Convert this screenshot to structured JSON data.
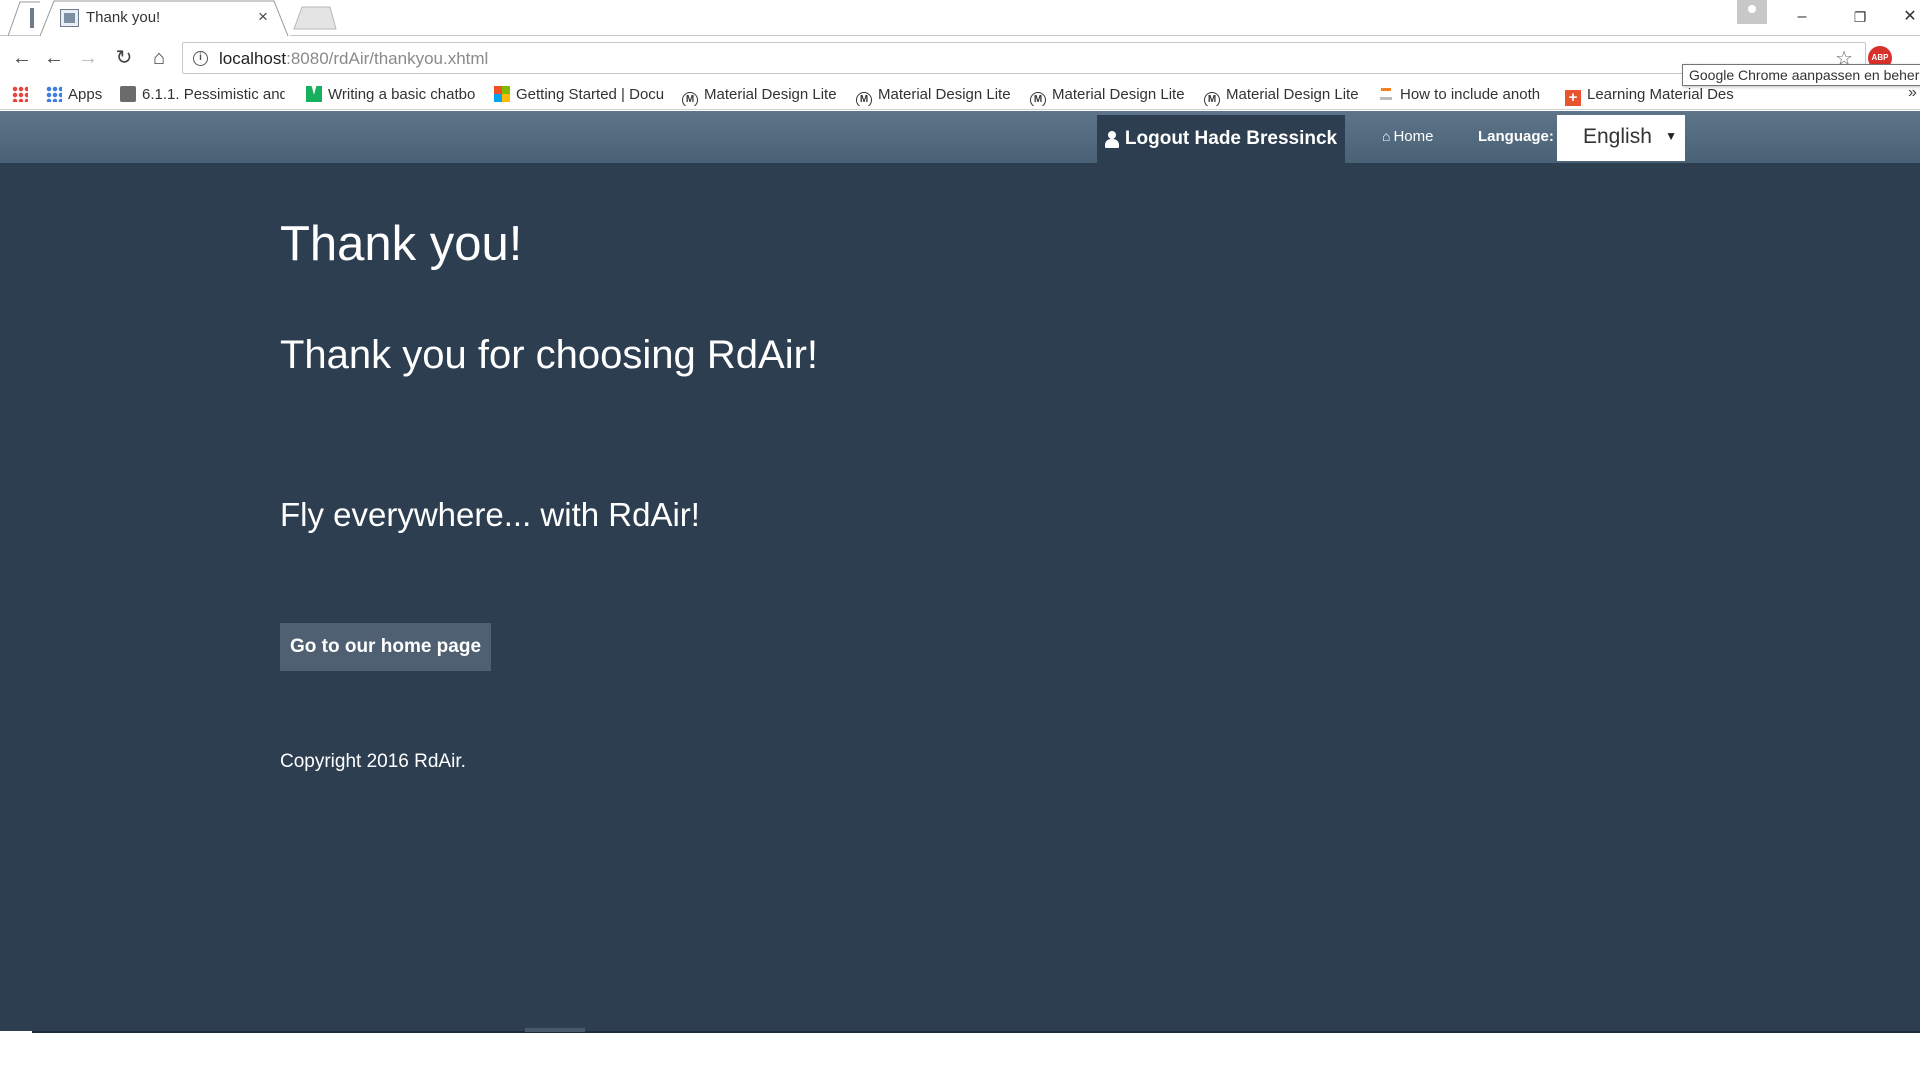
{
  "browser": {
    "tab": {
      "title": "Thank you!",
      "close_glyph": "×"
    },
    "window": {
      "minimize": "–",
      "restore": "❐",
      "close": "✕"
    },
    "omnibox": {
      "host": "localhost",
      "path": ":8080/rdAir/thankyou.xhtml"
    },
    "tooltip": "Google Chrome aanpassen en beheren",
    "bookmarks": [
      {
        "label": "Apps",
        "icon": "apps-grid-icon"
      },
      {
        "label": "6.1.1. Pessimistic and",
        "icon": "jboss-icon"
      },
      {
        "label": "Writing a basic chatbo",
        "icon": "medium-icon"
      },
      {
        "label": "Getting Started | Docu",
        "icon": "microsoft-icon"
      },
      {
        "label": "Material Design Lite",
        "icon": "material-icon"
      },
      {
        "label": "Material Design Lite",
        "icon": "material-icon"
      },
      {
        "label": "Material Design Lite",
        "icon": "material-icon"
      },
      {
        "label": "Material Design Lite",
        "icon": "material-icon"
      },
      {
        "label": "How to include anoth",
        "icon": "stackoverflow-icon"
      },
      {
        "label": "Learning Material Des",
        "icon": "plus-icon"
      }
    ]
  },
  "site": {
    "nav": {
      "logout_label": "Logout Hade Bressinck",
      "home_label": "Home",
      "language_label": "Language:",
      "language_selected": "English"
    },
    "heading": "Thank you!",
    "subheading": "Thank you for choosing RdAir!",
    "tagline": "Fly everywhere... with RdAir!",
    "home_button": "Go to our home page",
    "copyright": "Copyright 2016 RdAir."
  },
  "colors": {
    "page_background": "#2c3e50",
    "nav_gradient_top": "#5e7589",
    "nav_gradient_bottom": "#4a6276",
    "button_background": "#4f6073"
  }
}
